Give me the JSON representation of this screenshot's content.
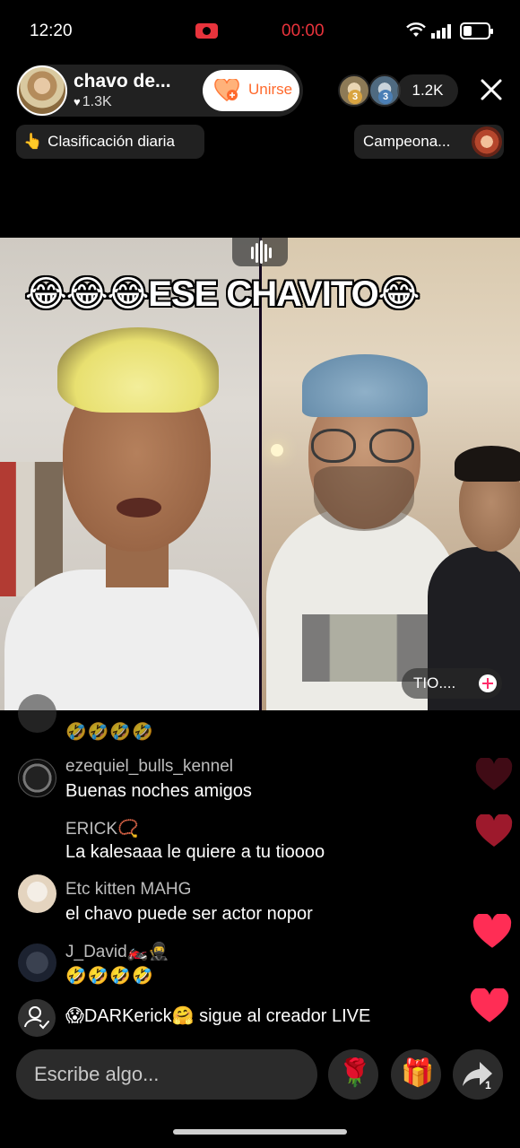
{
  "status_bar": {
    "time": "12:20",
    "record_time": "00:00"
  },
  "host": {
    "name": "chavo de...",
    "likes": "1.3K",
    "join_label": "Unirse"
  },
  "viewers": {
    "count": "1.2K",
    "ranks": [
      "3",
      "3"
    ]
  },
  "chips": {
    "daily_ranking": "Clasificación diaria",
    "daily_emoji": "👆",
    "campeona": "Campeona..."
  },
  "video": {
    "overlay_title": "😂😂😂ESE CHAVITO😂",
    "guest_label": "TIO...."
  },
  "comments": [
    {
      "name": "",
      "text": "🤣🤣🤣🤣"
    },
    {
      "name": "ezequiel_bulls_kennel",
      "text": "Buenas noches amigos"
    },
    {
      "name": "ERICK📿",
      "text": "La kalesaaa le quiere a tu tioooo"
    },
    {
      "name": "Etc kitten MAHG",
      "text": "el chavo puede ser actor nopor"
    },
    {
      "name": "J_David🏍️🥷",
      "text": "🤣🤣🤣🤣"
    }
  ],
  "follow_notice": {
    "user": "😱DARKerick🤗",
    "action": " sigue al creador LIVE"
  },
  "composer": {
    "placeholder": "Escribe algo..."
  },
  "buttons": {
    "rose_icon": "🌹",
    "gift_icon": "🎁",
    "share_count": "1"
  },
  "colors": {
    "accent": "#ff6a2d",
    "live_red": "#e8333c",
    "heart": "#ff2d55"
  }
}
